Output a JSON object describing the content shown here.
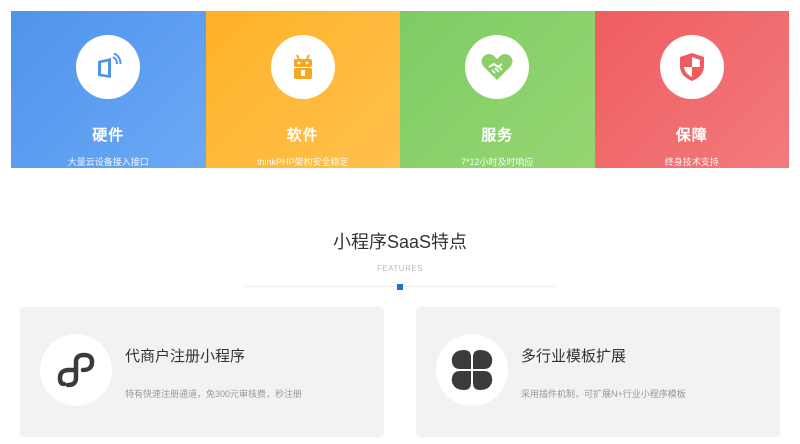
{
  "tiles": [
    {
      "title": "硬件",
      "subtitle": "大量云设备接入接口",
      "icon": "tablet-signal-icon",
      "color": "#4f93ec"
    },
    {
      "title": "软件",
      "subtitle": "thinkPHP架构安全稳定",
      "icon": "android-icon",
      "color": "#ffb127"
    },
    {
      "title": "服务",
      "subtitle": "7*12小时及时响应",
      "icon": "handshake-heart-icon",
      "color": "#7dcc63"
    },
    {
      "title": "保障",
      "subtitle": "终身技术支持",
      "icon": "shield-icon",
      "color": "#f05d5f"
    }
  ],
  "section": {
    "title": "小程序SaaS特点",
    "subtitle": "FEATURES",
    "accent": "#1e6fd9"
  },
  "features": [
    {
      "title": "代商户注册小程序",
      "description": "特有快速注册通道，免300元审核费，秒注册",
      "icon": "mini-program-icon"
    },
    {
      "title": "多行业模板扩展",
      "description": "采用插件机制，可扩展N+行业小程序模板",
      "icon": "four-petal-icon"
    }
  ]
}
